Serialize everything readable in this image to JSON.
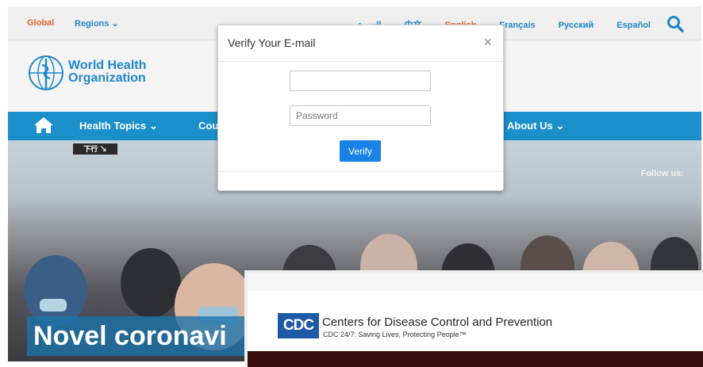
{
  "topbar": {
    "global_label": "Global",
    "regions_label": "Regions ⌄",
    "languages": [
      "العربية",
      "中文",
      "English",
      "Français",
      "Русский",
      "Español"
    ],
    "active_language": "English",
    "accent_color": "#e2652c",
    "link_color": "#1f87c9"
  },
  "header": {
    "logo_line1": "World Health",
    "logo_line2": "Organization"
  },
  "nav": {
    "items": [
      "Health Topics ⌄",
      "Cou",
      "About Us ⌄"
    ],
    "bar_color": "#1a8fc9"
  },
  "hero": {
    "follow_label": "Follow us:",
    "sign_text": "下行 ↘",
    "headline": "Novel coronavi"
  },
  "modal": {
    "title": "Verify Your E-mail",
    "close_label": "×",
    "email_value": "",
    "password_placeholder": "Password",
    "verify_label": "Verify",
    "button_color": "#1a82e6"
  },
  "cdc": {
    "logo_text": "CDC",
    "name": "Centers for Disease Control and Prevention",
    "tagline": "CDC 24/7: Saving Lives, Protecting People™"
  }
}
